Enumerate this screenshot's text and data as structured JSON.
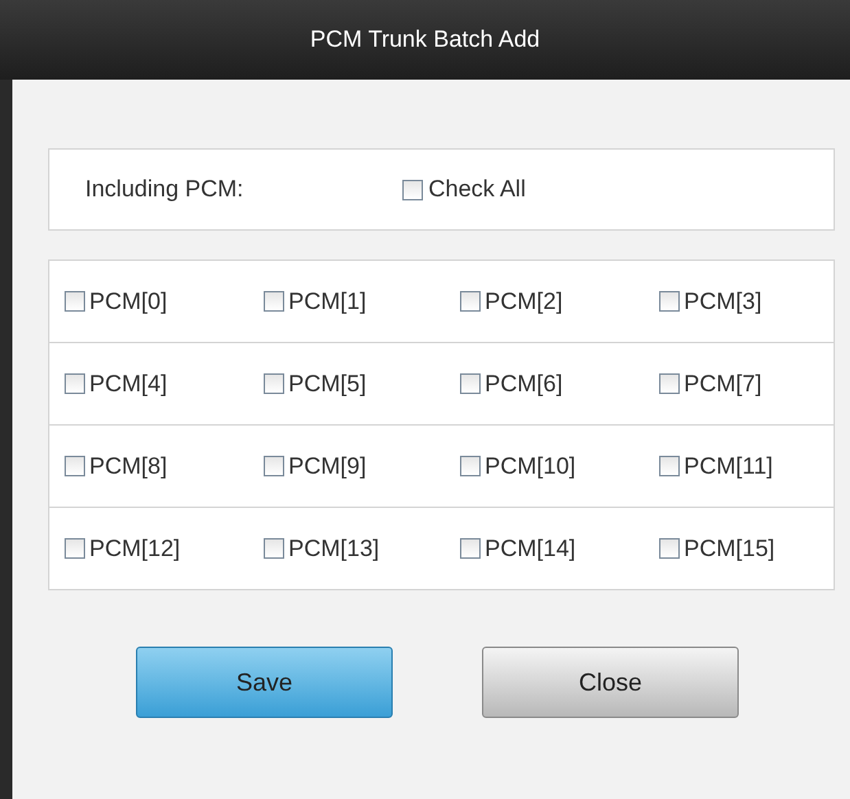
{
  "window": {
    "title": "PCM Trunk Batch Add"
  },
  "including": {
    "label": "Including PCM:",
    "check_all": {
      "label": "Check All",
      "checked": false
    }
  },
  "pcms": [
    [
      {
        "label": "PCM[0]",
        "checked": false
      },
      {
        "label": "PCM[1]",
        "checked": false
      },
      {
        "label": "PCM[2]",
        "checked": false
      },
      {
        "label": "PCM[3]",
        "checked": false
      }
    ],
    [
      {
        "label": "PCM[4]",
        "checked": false
      },
      {
        "label": "PCM[5]",
        "checked": false
      },
      {
        "label": "PCM[6]",
        "checked": false
      },
      {
        "label": "PCM[7]",
        "checked": false
      }
    ],
    [
      {
        "label": "PCM[8]",
        "checked": false
      },
      {
        "label": "PCM[9]",
        "checked": false
      },
      {
        "label": "PCM[10]",
        "checked": false
      },
      {
        "label": "PCM[11]",
        "checked": false
      }
    ],
    [
      {
        "label": "PCM[12]",
        "checked": false
      },
      {
        "label": "PCM[13]",
        "checked": false
      },
      {
        "label": "PCM[14]",
        "checked": false
      },
      {
        "label": "PCM[15]",
        "checked": false
      }
    ]
  ],
  "buttons": [
    {
      "label": "Save",
      "kind": "primary"
    },
    {
      "label": "Close",
      "kind": "secondary"
    }
  ]
}
